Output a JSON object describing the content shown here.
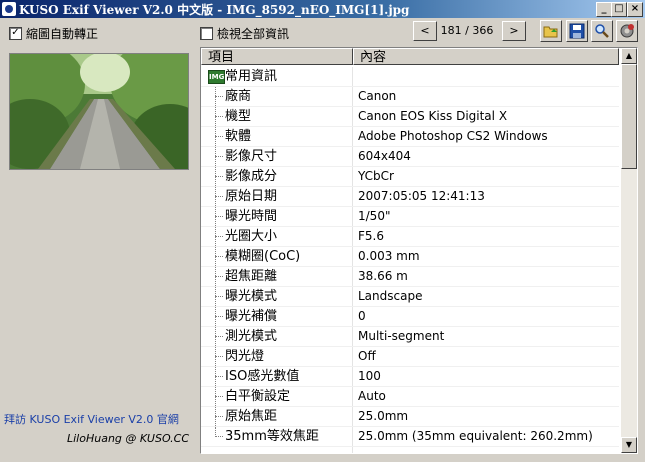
{
  "window": {
    "title": "KUSO Exif Viewer V2.0 中文版 - IMG_8592_nEO_IMG[1].jpg",
    "minimize": "_",
    "maximize": "□",
    "close": "×"
  },
  "toolbar": {
    "auto_rotate_label": "縮圖自動轉正",
    "auto_rotate_checked": true,
    "show_all_label": "檢視全部資訊",
    "show_all_checked": false,
    "prev_label": "<",
    "next_label": ">",
    "page_counter": "181 / 366",
    "icons": [
      "open-folder-icon",
      "save-icon",
      "search-icon",
      "settings-gear-icon"
    ]
  },
  "table": {
    "columns": [
      "項目",
      "內容"
    ],
    "group": "常用資訊",
    "rows": [
      {
        "key": "廠商",
        "value": "Canon"
      },
      {
        "key": "機型",
        "value": "Canon EOS Kiss Digital X"
      },
      {
        "key": "軟體",
        "value": "Adobe Photoshop CS2 Windows"
      },
      {
        "key": "影像尺寸",
        "value": "604x404"
      },
      {
        "key": "影像成分",
        "value": "YCbCr"
      },
      {
        "key": "原始日期",
        "value": "2007:05:05 12:41:13"
      },
      {
        "key": "曝光時間",
        "value": "1/50\""
      },
      {
        "key": "光圈大小",
        "value": "F5.6"
      },
      {
        "key": "模糊圈(CoC)",
        "value": "0.003 mm"
      },
      {
        "key": "超焦距離",
        "value": "38.66 m"
      },
      {
        "key": "曝光模式",
        "value": "Landscape"
      },
      {
        "key": "曝光補償",
        "value": "0"
      },
      {
        "key": "測光模式",
        "value": "Multi-segment"
      },
      {
        "key": "閃光燈",
        "value": "Off"
      },
      {
        "key": "ISO感光數值",
        "value": "100"
      },
      {
        "key": "白平衡設定",
        "value": "Auto"
      },
      {
        "key": "原始焦距",
        "value": "25.0mm"
      },
      {
        "key": "35mm等效焦距",
        "value": "25.0mm (35mm equivalent: 260.2mm)"
      }
    ]
  },
  "credits": {
    "visit": "拜訪 KUSO Exif Viewer V2.0 官網",
    "author": "LiloHuang @ KUSO.CC"
  },
  "colors": {
    "title_bar": "#0a246a",
    "face": "#d4d0c8",
    "link": "#1a3fa8"
  }
}
